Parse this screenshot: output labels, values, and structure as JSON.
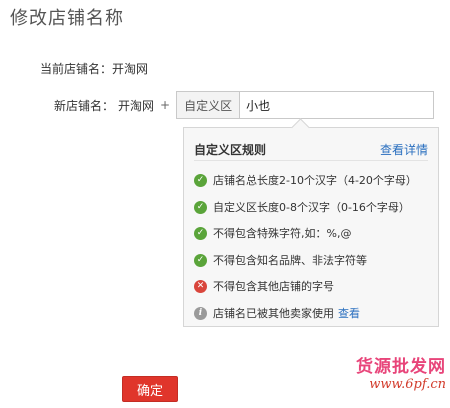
{
  "page": {
    "title": "修改店铺名称"
  },
  "current": {
    "label": "当前店铺名：",
    "value": "开淘网"
  },
  "new_name": {
    "label": "新店铺名：",
    "prefix": "开淘网",
    "plus": "+",
    "box_label": "自定义区",
    "input_value": "小也"
  },
  "rules": {
    "title": "自定义区规则",
    "details_link": "查看详情",
    "items": [
      {
        "icon": "check-icon",
        "status": "ok",
        "text": "店铺名总长度2-10个汉字（4-20个字母）"
      },
      {
        "icon": "check-icon",
        "status": "ok",
        "text": "自定义区长度0-8个汉字（0-16个字母）"
      },
      {
        "icon": "check-icon",
        "status": "ok",
        "text": "不得包含特殊字符,如：%,@"
      },
      {
        "icon": "check-icon",
        "status": "ok",
        "text": "不得包含知名品牌、非法字符等"
      },
      {
        "icon": "error-icon",
        "status": "error",
        "text": "不得包含其他店铺的字号"
      },
      {
        "icon": "info-icon",
        "status": "info",
        "text": "店铺名已被其他卖家使用",
        "link": "查看"
      }
    ]
  },
  "actions": {
    "confirm": "确定"
  },
  "watermark": {
    "text": "货源批发网",
    "url": "www.6pf.cn"
  },
  "colors": {
    "accent": "#e0352b",
    "link": "#2a6fbf",
    "ok": "#5aa43a",
    "error": "#d9453b"
  }
}
